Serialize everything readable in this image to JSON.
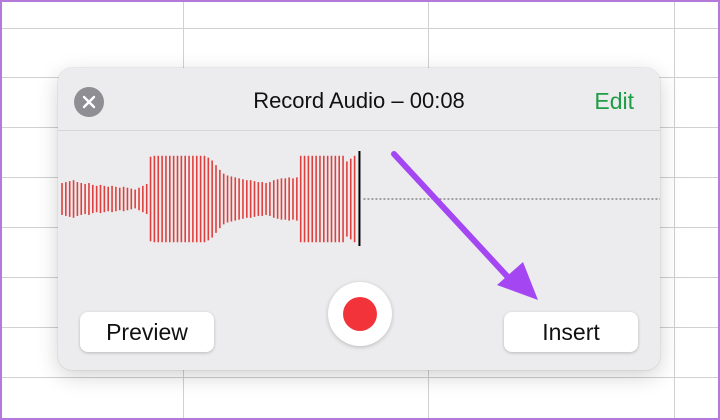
{
  "dialog": {
    "title": "Record Audio – 00:08",
    "edit_label": "Edit",
    "close_icon": "close-icon",
    "record_icon": "record-icon"
  },
  "buttons": {
    "preview_label": "Preview",
    "insert_label": "Insert"
  },
  "waveform": {
    "color": "#e0403d",
    "playhead_color": "#000000",
    "levels": [
      0.34,
      0.36,
      0.38,
      0.4,
      0.36,
      0.34,
      0.32,
      0.34,
      0.3,
      0.28,
      0.3,
      0.28,
      0.26,
      0.28,
      0.26,
      0.24,
      0.26,
      0.24,
      0.22,
      0.2,
      0.24,
      0.28,
      0.32,
      0.9,
      0.92,
      0.92,
      0.92,
      0.92,
      0.92,
      0.92,
      0.92,
      0.92,
      0.92,
      0.92,
      0.92,
      0.92,
      0.92,
      0.92,
      0.88,
      0.82,
      0.72,
      0.62,
      0.54,
      0.5,
      0.48,
      0.46,
      0.44,
      0.42,
      0.4,
      0.4,
      0.38,
      0.36,
      0.36,
      0.34,
      0.36,
      0.4,
      0.42,
      0.44,
      0.44,
      0.46,
      0.44,
      0.46,
      0.92,
      0.92,
      0.92,
      0.92,
      0.92,
      0.92,
      0.92,
      0.92,
      0.92,
      0.92,
      0.92,
      0.92,
      0.8,
      0.86,
      0.92
    ]
  },
  "annotation": {
    "arrow_color": "#a447f2"
  },
  "colors": {
    "accent_green": "#1f9e46",
    "record_red": "#f2343a"
  }
}
